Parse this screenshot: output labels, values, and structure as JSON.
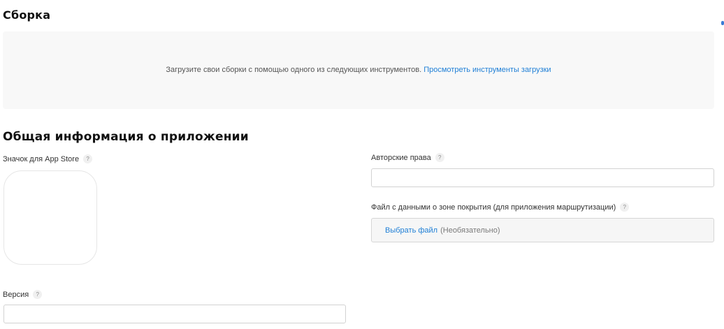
{
  "build": {
    "title": "Сборка",
    "message": "Загрузите свои сборки с помощью одного из следующих инструментов.",
    "link_label": "Просмотреть инструменты загрузки"
  },
  "general": {
    "title": "Общая информация о приложении",
    "app_icon_label": "Значок для App Store",
    "version_label": "Версия",
    "version_value": "",
    "copyright_label": "Авторские права",
    "copyright_value": "",
    "routing_file_label": "Файл с данными о зоне покрытия (для приложения маршрутизации)",
    "choose_file_label": "Выбрать файл",
    "optional_label": "(Необязательно)",
    "help_glyph": "?"
  }
}
